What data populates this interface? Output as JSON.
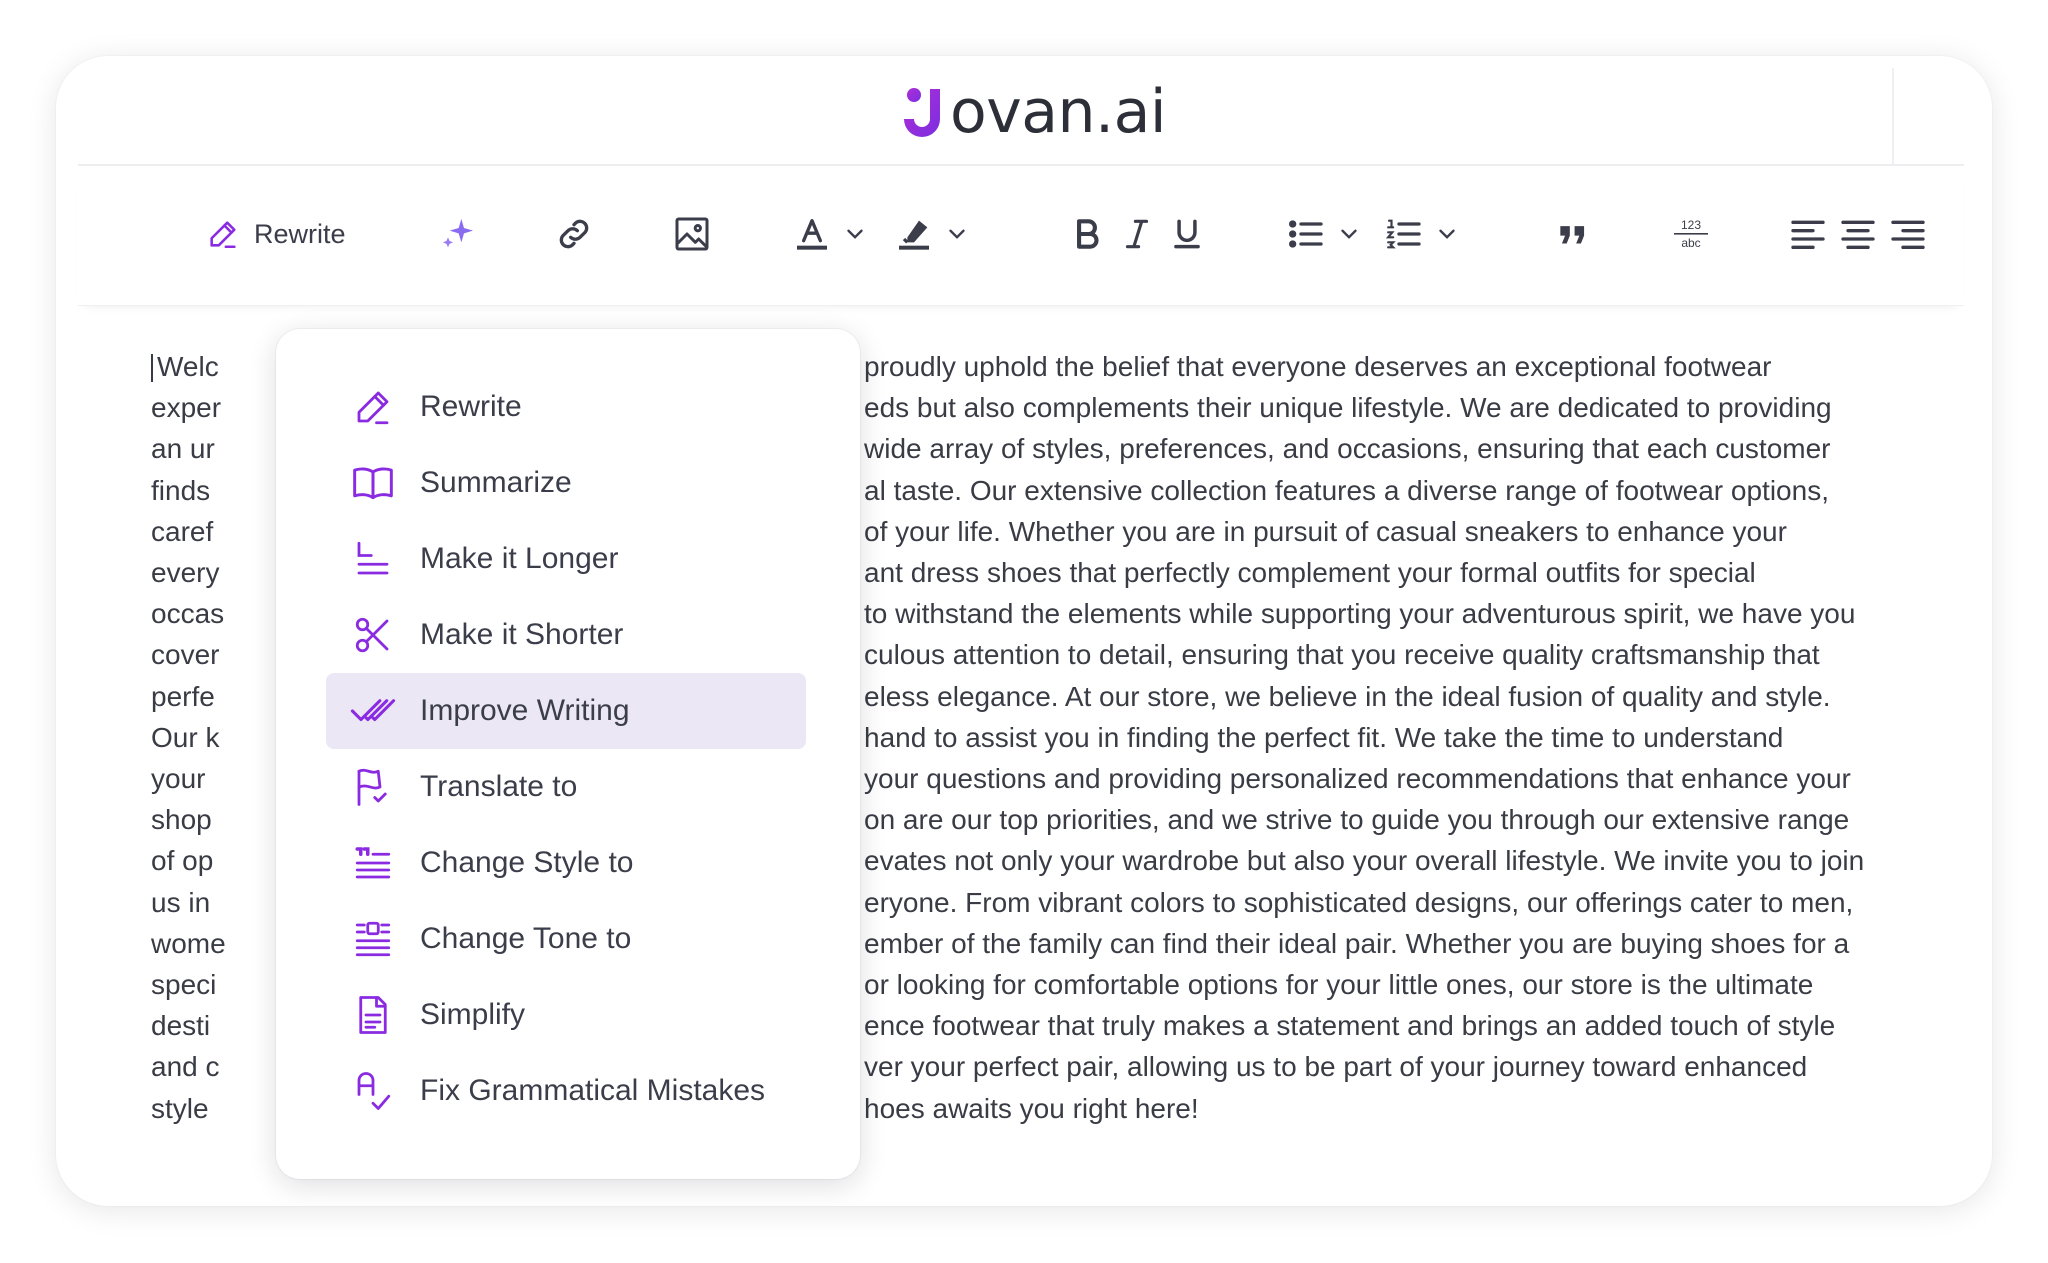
{
  "brand": {
    "name": "Jovan.ai",
    "name_rest": "ovan.ai",
    "accent": "#8a2be2"
  },
  "toolbar": {
    "rewrite_label": "Rewrite",
    "icons": [
      "sparkle-icon",
      "link-icon",
      "image-icon",
      "text-color-icon",
      "highlight-icon",
      "bold-icon",
      "italic-icon",
      "underline-icon",
      "bullet-list-icon",
      "numbered-list-icon",
      "blockquote-icon",
      "text-case-icon",
      "align-left-icon",
      "align-center-icon",
      "align-right-icon"
    ],
    "text_case_glyph_top": "123",
    "text_case_glyph_bottom": "abc"
  },
  "editor": {
    "lines": [
      {
        "left": "Welc",
        "right": "proudly uphold the belief that everyone deserves an exceptional footwear"
      },
      {
        "left": "exper",
        "right": "eds but also complements their unique lifestyle. We are dedicated to providing"
      },
      {
        "left": "an ur",
        "right": "wide array of styles, preferences, and occasions, ensuring that each customer"
      },
      {
        "left": "finds",
        "right": "al taste. Our extensive collection features a diverse range of footwear options,"
      },
      {
        "left": "caref",
        "right": "of your life. Whether you are in pursuit of casual sneakers to enhance your"
      },
      {
        "left": "every",
        "right": "ant dress shoes that perfectly complement your formal outfits for special"
      },
      {
        "left": "occas",
        "right": "to withstand the elements while supporting your adventurous spirit, we have you"
      },
      {
        "left": "cover",
        "right": "culous attention to detail, ensuring that you receive quality craftsmanship that"
      },
      {
        "left": "perfe",
        "right": "eless elegance. At our store, we believe in the ideal fusion of quality and style."
      },
      {
        "left": "Our k",
        "right": "hand to assist you in finding the perfect fit. We take the time to understand"
      },
      {
        "left": "your",
        "right": "your questions and providing personalized recommendations that enhance your"
      },
      {
        "left": "shop",
        "right": "on are our top priorities, and we strive to guide you through our extensive range"
      },
      {
        "left": "of op",
        "right": "evates not only your wardrobe but also your overall lifestyle. We invite you to join"
      },
      {
        "left": "us in",
        "right": "eryone. From vibrant colors to sophisticated designs, our offerings cater to men,"
      },
      {
        "left": "wome",
        "right": "ember of the family can find their ideal pair. Whether you are buying shoes for a"
      },
      {
        "left": "speci",
        "right": "or looking for comfortable options for your little ones, our store is the ultimate"
      },
      {
        "left": "desti",
        "right": "ence footwear that truly makes a statement and brings an added touch of style"
      },
      {
        "left": "and c",
        "right": "ver your perfect pair, allowing us to be part of your journey toward enhanced"
      },
      {
        "left": "style",
        "right": "hoes awaits you right here!"
      }
    ]
  },
  "menu": {
    "active_index": 4,
    "items": [
      {
        "label": "Rewrite",
        "icon": "pencil-icon"
      },
      {
        "label": "Summarize",
        "icon": "book-icon"
      },
      {
        "label": "Make it Longer",
        "icon": "lengthen-icon"
      },
      {
        "label": "Make it Shorter",
        "icon": "scissors-icon"
      },
      {
        "label": "Improve Writing",
        "icon": "double-check-icon"
      },
      {
        "label": "Translate to",
        "icon": "flag-check-icon"
      },
      {
        "label": "Change Style to",
        "icon": "quote-lines-icon"
      },
      {
        "label": "Change Tone to",
        "icon": "tone-lines-icon"
      },
      {
        "label": "Simplify",
        "icon": "document-icon"
      },
      {
        "label": "Fix Grammatical Mistakes",
        "icon": "spellcheck-icon"
      }
    ]
  }
}
